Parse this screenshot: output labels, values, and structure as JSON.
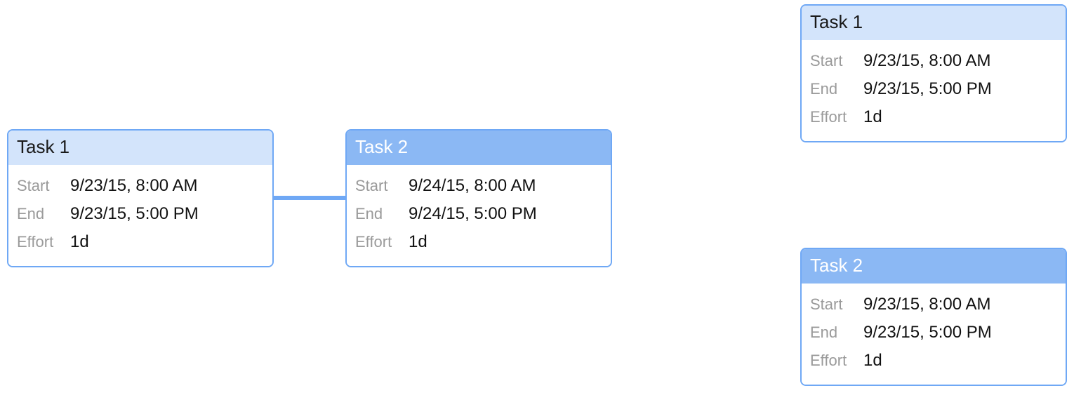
{
  "colors": {
    "border": "#6fa8f5",
    "header_light": "#d3e4fb",
    "header_dark": "#8bb8f4"
  },
  "labels": {
    "start": "Start",
    "end": "End",
    "effort": "Effort"
  },
  "left": {
    "task1": {
      "title": "Task 1",
      "start": "9/23/15, 8:00 AM",
      "end": "9/23/15, 5:00 PM",
      "effort": "1d"
    },
    "task2": {
      "title": "Task 2",
      "start": "9/24/15, 8:00 AM",
      "end": "9/24/15, 5:00 PM",
      "effort": "1d"
    }
  },
  "right": {
    "task1": {
      "title": "Task 1",
      "start": "9/23/15, 8:00 AM",
      "end": "9/23/15, 5:00 PM",
      "effort": "1d"
    },
    "task2": {
      "title": "Task 2",
      "start": "9/23/15, 8:00 AM",
      "end": "9/23/15, 5:00 PM",
      "effort": "1d"
    }
  }
}
